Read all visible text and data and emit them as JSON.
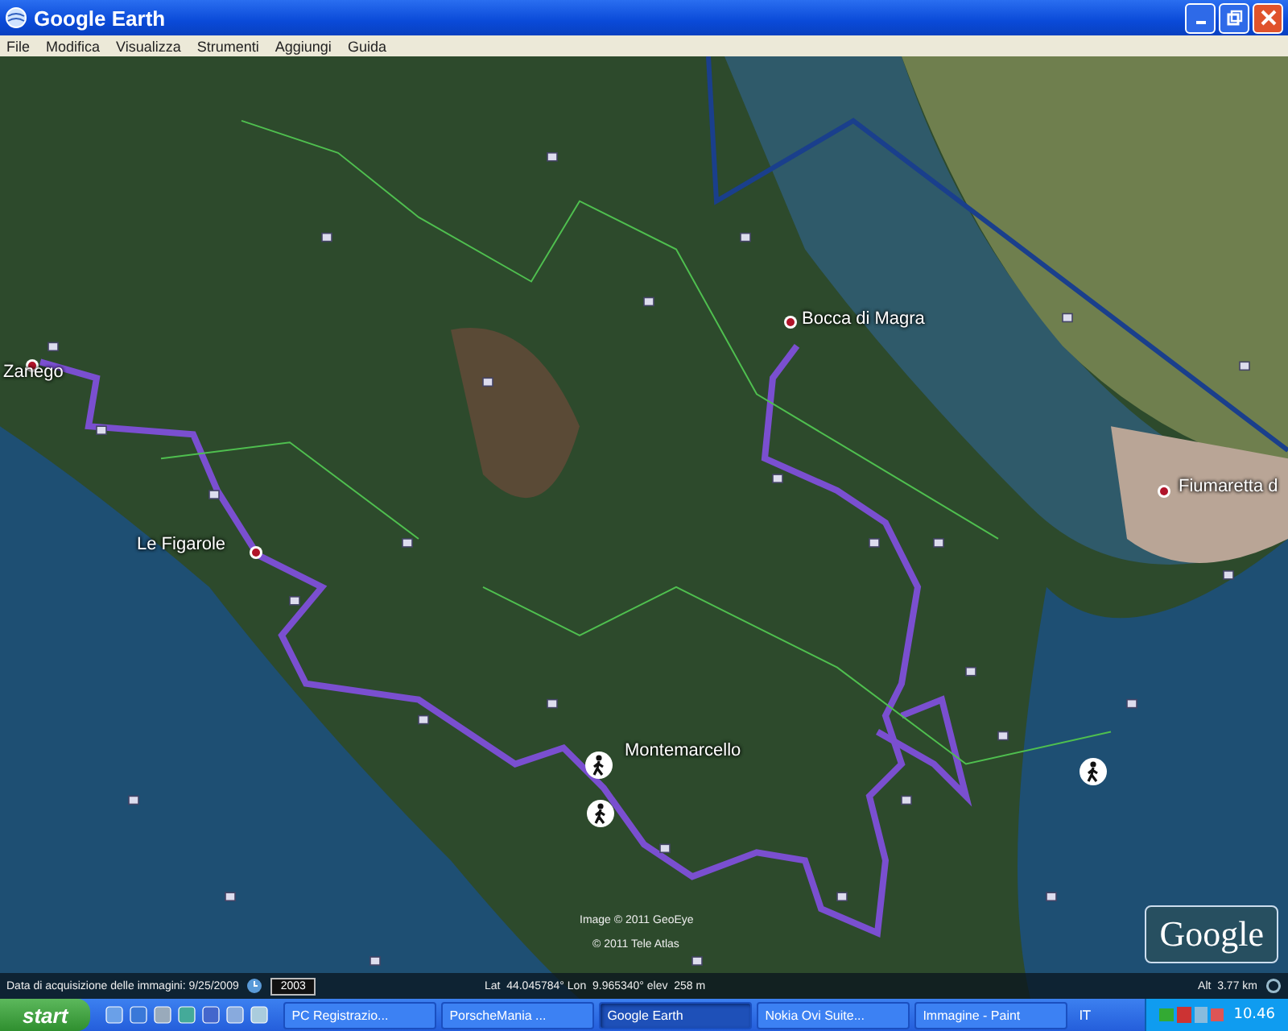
{
  "window": {
    "title": "Google Earth"
  },
  "menu": [
    "File",
    "Modifica",
    "Visualizza",
    "Strumenti",
    "Aggiungi",
    "Guida"
  ],
  "map": {
    "places": [
      {
        "name": "Zanego"
      },
      {
        "name": "Bocca di Magra"
      },
      {
        "name": "Fiumaretta d"
      },
      {
        "name": "Le Figarole"
      },
      {
        "name": "Montemarcello"
      }
    ],
    "attributions": [
      "Image © 2011 GeoEye",
      "© 2011 Tele Atlas"
    ],
    "logo": "Google"
  },
  "status_bar": {
    "acquisition": "Data di acquisizione delle immagini: 9/25/2009",
    "year": "2003",
    "coords": "Lat  44.045784° Lon  9.965340° elev  258 m",
    "altitude": "Alt  3.77 km"
  },
  "taskbar": {
    "start": "start",
    "tasks": [
      {
        "label": "PC Registrazio...",
        "selected": false
      },
      {
        "label": "PorscheMania ...",
        "selected": false
      },
      {
        "label": "Google Earth",
        "selected": true
      },
      {
        "label": "Nokia Ovi Suite...",
        "selected": false
      },
      {
        "label": "Immagine - Paint",
        "selected": false
      }
    ],
    "language": "IT",
    "clock": "10.46"
  }
}
